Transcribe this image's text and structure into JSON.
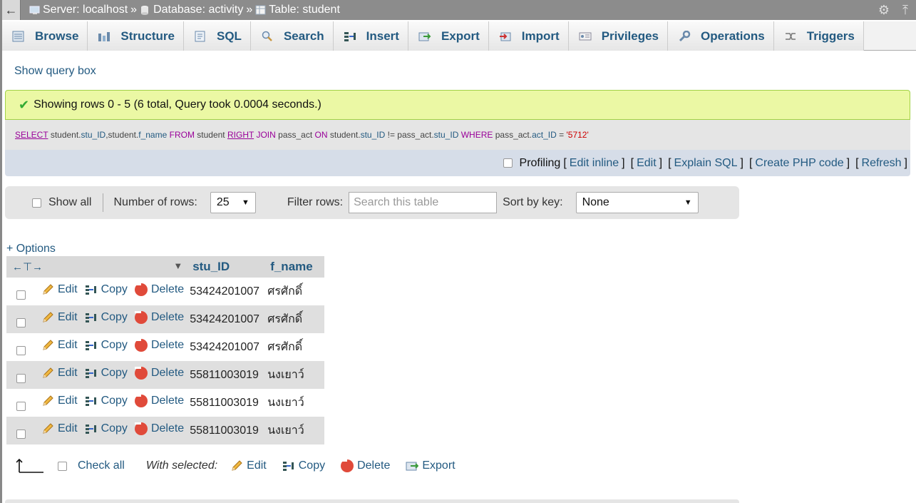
{
  "breadcrumb": {
    "server": "Server: localhost",
    "database": "Database: activity",
    "table": "Table: student",
    "separator": "»"
  },
  "tabs": [
    {
      "label": "Browse",
      "icon": "browse-icon"
    },
    {
      "label": "Structure",
      "icon": "structure-icon"
    },
    {
      "label": "SQL",
      "icon": "sql-icon"
    },
    {
      "label": "Search",
      "icon": "search-icon"
    },
    {
      "label": "Insert",
      "icon": "insert-icon"
    },
    {
      "label": "Export",
      "icon": "export-icon"
    },
    {
      "label": "Import",
      "icon": "import-icon"
    },
    {
      "label": "Privileges",
      "icon": "privileges-icon"
    },
    {
      "label": "Operations",
      "icon": "operations-icon"
    },
    {
      "label": "Triggers",
      "icon": "triggers-icon"
    }
  ],
  "show_query_box": "Show query box",
  "message": "Showing rows 0 - 5 (6 total, Query took 0.0004 seconds.)",
  "sql": {
    "select": "SELECT",
    "cols_a": "student.",
    "c1": "stu_ID",
    "comma": ",student.",
    "c2": "f_name",
    "from": "FROM",
    "t1": "student",
    "right": "RIGHT",
    "join": "JOIN",
    "t2": "pass_act",
    "on": "ON",
    "p1": "student.",
    "c3": "stu_ID",
    "neq": "!=",
    "p2": "pass_act.",
    "c4": "stu_ID",
    "where": "WHERE",
    "p3": "pass_act.",
    "c5": "act_ID",
    "eq": "=",
    "val": "'5712'"
  },
  "sql_actions": {
    "profiling": "Profiling",
    "edit_inline": "Edit inline",
    "edit": "Edit",
    "explain": "Explain SQL",
    "php": "Create PHP code",
    "refresh": "Refresh"
  },
  "nav": {
    "show_all": "Show all",
    "rows_label": "Number of rows:",
    "rows_value": "25",
    "filter_label": "Filter rows:",
    "filter_placeholder": "Search this table",
    "sort_label": "Sort by key:",
    "sort_value": "None"
  },
  "options": "+ Options",
  "table": {
    "columns": [
      "stu_ID",
      "f_name"
    ],
    "action_labels": {
      "edit": "Edit",
      "copy": "Copy",
      "delete": "Delete"
    },
    "rows": [
      {
        "stu_ID": "53424201007",
        "f_name": "ศรศักดิ์"
      },
      {
        "stu_ID": "53424201007",
        "f_name": "ศรศักดิ์"
      },
      {
        "stu_ID": "53424201007",
        "f_name": "ศรศักดิ์"
      },
      {
        "stu_ID": "55811003019",
        "f_name": "นงเยาว์"
      },
      {
        "stu_ID": "55811003019",
        "f_name": "นงเยาว์"
      },
      {
        "stu_ID": "55811003019",
        "f_name": "นงเยาว์"
      }
    ]
  },
  "bulk": {
    "check_all": "Check all",
    "with_selected": "With selected:",
    "edit": "Edit",
    "copy": "Copy",
    "delete": "Delete",
    "export": "Export"
  },
  "colors": {
    "link": "#235a81",
    "success_bg": "#ebf8a4",
    "delete": "#e04a3a"
  }
}
